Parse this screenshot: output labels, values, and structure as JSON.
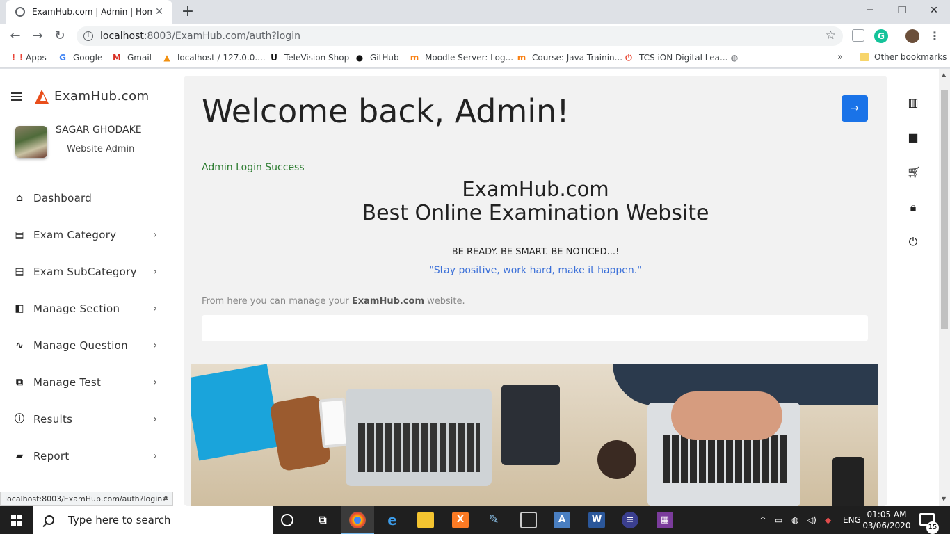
{
  "browser": {
    "tab_title": "ExamHub.com | Admin | Home",
    "new_tab": "+",
    "url_host": "localhost",
    "url_rest": ":8003/ExamHub.com/auth?login",
    "bookmarks": [
      {
        "label": "Apps",
        "icon": "apps-grid-icon"
      },
      {
        "label": "Google",
        "icon": "google-icon"
      },
      {
        "label": "Gmail",
        "icon": "gmail-icon"
      },
      {
        "label": "localhost / 127.0.0....",
        "icon": "phpmyadmin-icon"
      },
      {
        "label": "TeleVision Shop",
        "icon": "television-shop-icon"
      },
      {
        "label": "GitHub",
        "icon": "github-icon"
      },
      {
        "label": "Moodle Server: Log...",
        "icon": "moodle-icon"
      },
      {
        "label": "Course: Java Trainin...",
        "icon": "moodle-icon"
      },
      {
        "label": "TCS iON Digital Lea...",
        "icon": "tcs-ion-icon"
      }
    ],
    "more_bookmarks": "»",
    "other_bookmarks": "Other bookmarks",
    "status_url": "localhost:8003/ExamHub.com/auth?login#"
  },
  "sidebar": {
    "brand": "ExamHub.com",
    "user_name": "SAGAR GHODAKE",
    "user_role": "Website Admin",
    "items": [
      {
        "label": "Dashboard",
        "icon": "home-icon",
        "chevron": ""
      },
      {
        "label": "Exam Category",
        "icon": "book-icon",
        "chevron": "›"
      },
      {
        "label": "Exam SubCategory",
        "icon": "book-icon",
        "chevron": "›"
      },
      {
        "label": "Manage Section",
        "icon": "section-icon",
        "chevron": "›"
      },
      {
        "label": "Manage Question",
        "icon": "question-icon",
        "chevron": "›"
      },
      {
        "label": "Manage Test",
        "icon": "test-icon",
        "chevron": "›"
      },
      {
        "label": "Results",
        "icon": "info-icon",
        "chevron": "›"
      },
      {
        "label": "Report",
        "icon": "report-icon",
        "chevron": "›"
      }
    ]
  },
  "main": {
    "welcome": "Welcome back, Admin!",
    "go_arrow": "→",
    "alert": "Admin Login Success",
    "site_title": "ExamHub.com",
    "site_subtitle": "Best Online Examination Website",
    "motto": "BE READY. BE SMART. BE NOTICED...!",
    "quote": "\"Stay positive, work hard, make it happen.\"",
    "manage_prefix": "From here you can manage your ",
    "manage_site": "ExamHub.com",
    "manage_suffix": " website."
  },
  "rightbar": {
    "icons": [
      "bar-chart-icon",
      "folder-icon",
      "cart-icon",
      "lock-icon",
      "power-icon"
    ]
  },
  "taskbar": {
    "search_placeholder": "Type here to search",
    "language": "ENG",
    "time": "01:05 AM",
    "date": "03/06/2020",
    "notification_count": "15"
  }
}
